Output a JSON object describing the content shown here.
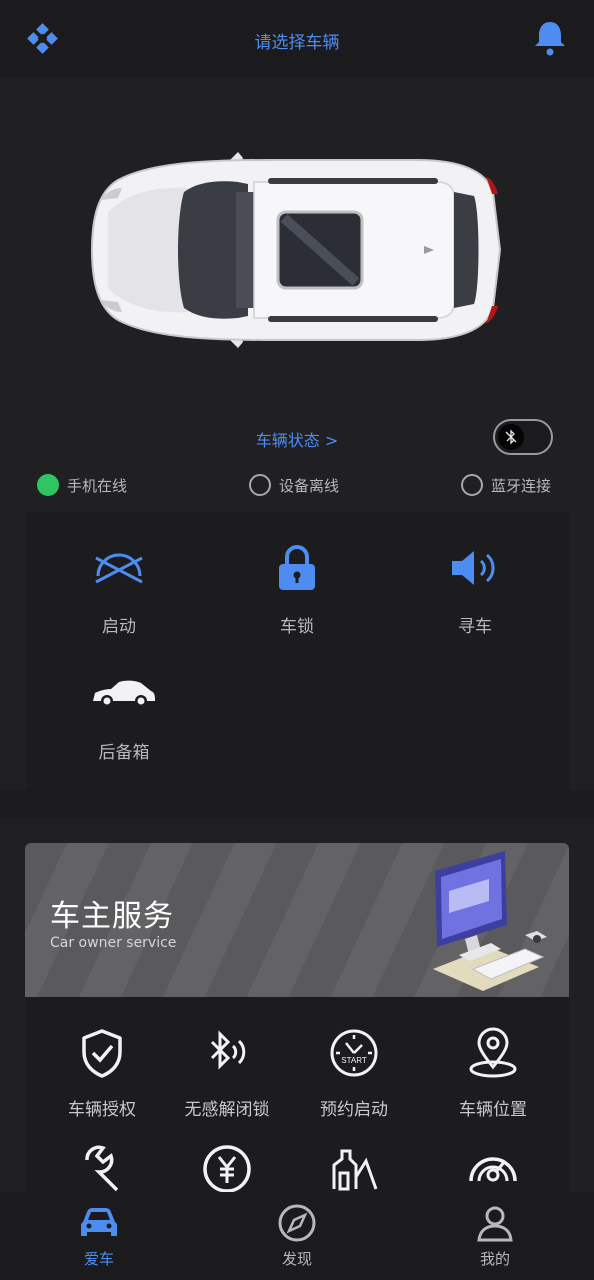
{
  "header": {
    "title": "请选择车辆"
  },
  "vehicle": {
    "status_link": "车辆状态 >",
    "indicators": [
      {
        "label": "手机在线",
        "state": "on"
      },
      {
        "label": "设备离线",
        "state": "off"
      },
      {
        "label": "蓝牙连接",
        "state": "off"
      }
    ]
  },
  "controls": [
    {
      "label": "启动",
      "icon": "engine-start-icon"
    },
    {
      "label": "车锁",
      "icon": "lock-icon"
    },
    {
      "label": "寻车",
      "icon": "horn-icon"
    },
    {
      "label": "后备箱",
      "icon": "trunk-car-icon"
    }
  ],
  "service": {
    "title": "车主服务",
    "subtitle": "Car owner service",
    "items": [
      {
        "label": "车辆授权",
        "icon": "shield-check-icon"
      },
      {
        "label": "无感解闭锁",
        "icon": "bluetooth-signal-icon"
      },
      {
        "label": "预约启动",
        "icon": "clock-start-icon"
      },
      {
        "label": "车辆位置",
        "icon": "location-pin-icon"
      },
      {
        "label": "",
        "icon": "wrench-icon"
      },
      {
        "label": "",
        "icon": "yen-icon"
      },
      {
        "label": "",
        "icon": "building-icon"
      },
      {
        "label": "",
        "icon": "speedometer-icon"
      }
    ]
  },
  "tabbar": [
    {
      "label": "爱车",
      "icon": "car-tab-icon",
      "active": true
    },
    {
      "label": "发现",
      "icon": "compass-icon",
      "active": false
    },
    {
      "label": "我的",
      "icon": "user-icon",
      "active": false
    }
  ],
  "colors": {
    "accent": "#4d8cf0",
    "online": "#2fc563",
    "background": "#1b1b1d"
  }
}
